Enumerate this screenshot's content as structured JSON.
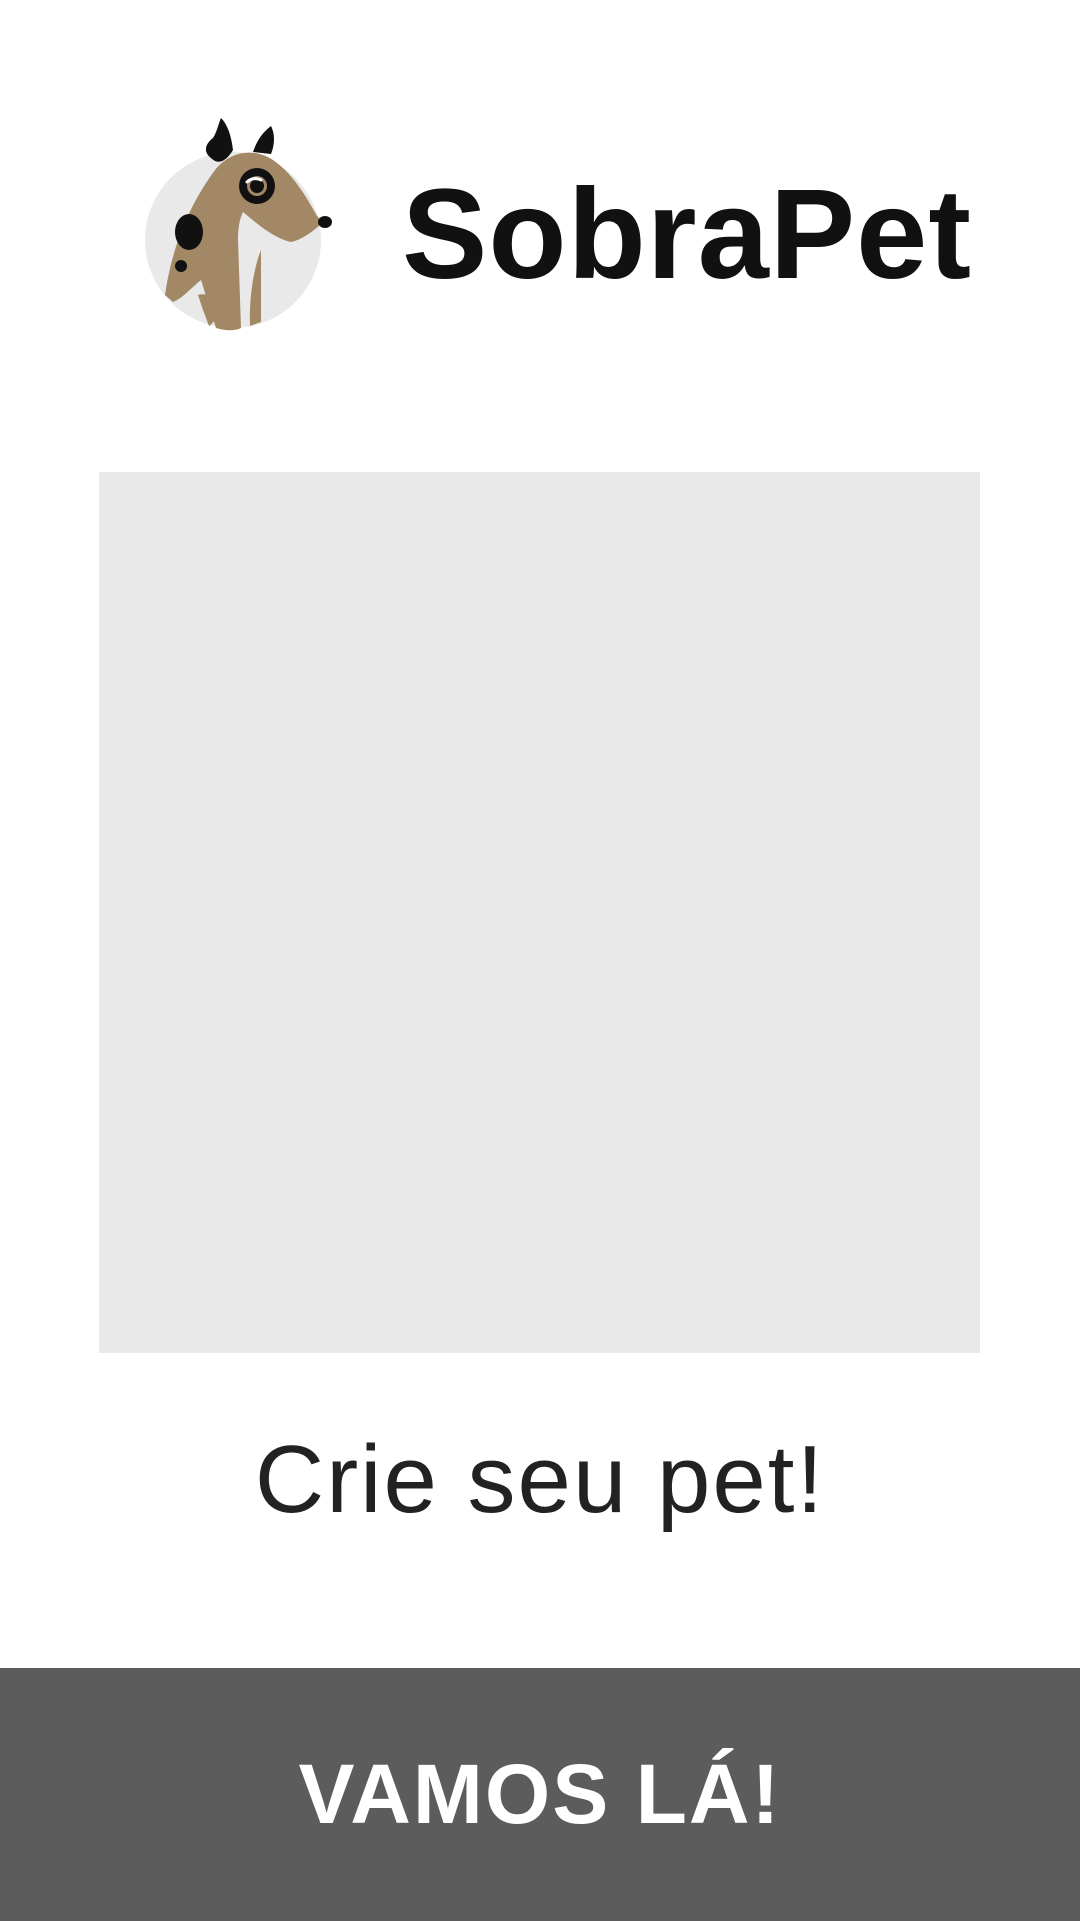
{
  "header": {
    "app_name": "SobraPet",
    "logo_icon": "dog-logo-icon"
  },
  "main": {
    "image_placeholder": "pet-image-placeholder",
    "tagline": "Crie seu pet!"
  },
  "footer": {
    "cta_label": "VAMOS LÁ!"
  },
  "colors": {
    "background": "#ffffff",
    "placeholder": "#e9e9e9",
    "cta_background": "#5c5c5c",
    "cta_text": "#ffffff",
    "dog_body": "#a38865",
    "logo_circle": "#e9e9e9",
    "text": "#111111"
  }
}
